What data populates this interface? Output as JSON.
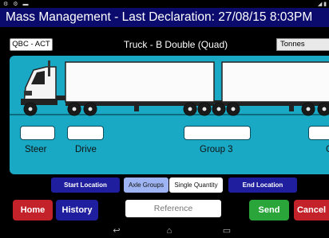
{
  "status_bar": {
    "left_icons": "⚙ ⚙ ▬",
    "right_icons": "◢ ▮"
  },
  "title": "Mass Management - Last Declaration: 27/08/15 8:03PM",
  "state": "QBC - ACT",
  "truck_type": "Truck - B Double (Quad)",
  "units": "Tonnes",
  "axle_groups": [
    {
      "label": "Steer",
      "value": ""
    },
    {
      "label": "Drive",
      "value": ""
    },
    {
      "label": "Group 3",
      "value": ""
    },
    {
      "label": "G",
      "value": ""
    }
  ],
  "segments": {
    "start_location": "Start Location",
    "axle_groups": "Axle Groups",
    "single_quantity": "Single Quantity",
    "end_location": "End Location"
  },
  "buttons": {
    "home": "Home",
    "history": "History",
    "send": "Send",
    "cancel": "Cancel"
  },
  "reference": {
    "placeholder": "Reference",
    "value": ""
  },
  "nav": {
    "back": "↩",
    "home": "⌂",
    "recents": "▭"
  }
}
